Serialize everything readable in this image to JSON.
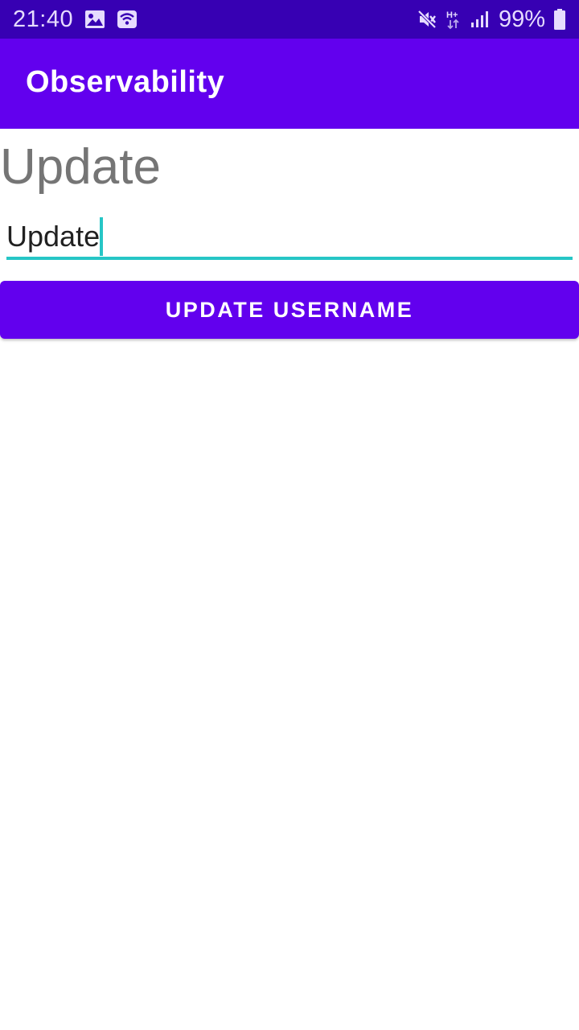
{
  "status_bar": {
    "time": "21:40",
    "left_icons": [
      "image-icon",
      "wifi-hotspot-icon"
    ],
    "right_icons": [
      "mute-icon",
      "network-hplus-icon",
      "signal-icon"
    ],
    "battery_percent": "99%",
    "battery_icon": "battery-icon"
  },
  "app_bar": {
    "title": "Observability"
  },
  "main": {
    "current_username": "Update",
    "username_input": {
      "value": "Update",
      "placeholder": ""
    },
    "update_button_label": "UPDATE USERNAME"
  },
  "colors": {
    "status_bar": "#3700b3",
    "primary": "#6200ee",
    "accent": "#26c6c6",
    "secondary_text": "#757575"
  }
}
